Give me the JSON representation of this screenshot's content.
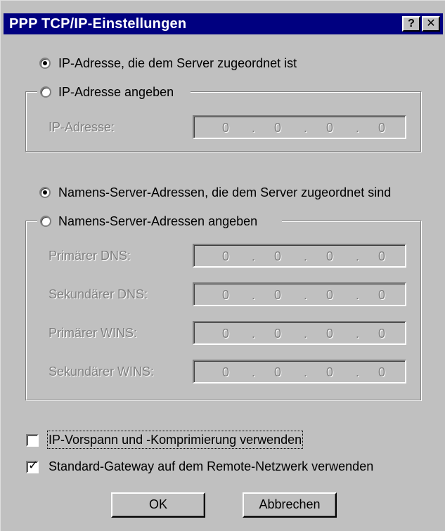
{
  "window": {
    "title": "PPP TCP/IP-Einstellungen",
    "help_glyph": "?",
    "close_glyph": "✕"
  },
  "ip": {
    "server_assigned_label": "IP-Adresse, die dem Server zugeordnet ist",
    "server_assigned_selected": true,
    "specify_label": "IP-Adresse angeben",
    "specify_selected": false,
    "field_label": "IP-Adresse:",
    "field_value": [
      "0",
      "0",
      "0",
      "0"
    ]
  },
  "dns": {
    "server_assigned_label": "Namens-Server-Adressen, die dem Server zugeordnet sind",
    "server_assigned_selected": true,
    "specify_label": "Namens-Server-Adressen angeben",
    "specify_selected": false,
    "fields": [
      {
        "label": "Primärer DNS:",
        "value": [
          "0",
          "0",
          "0",
          "0"
        ]
      },
      {
        "label": "Sekundärer DNS:",
        "value": [
          "0",
          "0",
          "0",
          "0"
        ]
      },
      {
        "label": "Primärer WINS:",
        "value": [
          "0",
          "0",
          "0",
          "0"
        ]
      },
      {
        "label": "Sekundärer WINS:",
        "value": [
          "0",
          "0",
          "0",
          "0"
        ]
      }
    ]
  },
  "options": {
    "header_compression_label": "IP-Vorspann und -Komprimierung verwenden",
    "header_compression_checked": false,
    "default_gateway_label": "Standard-Gateway auf dem Remote-Netzwerk verwenden",
    "default_gateway_checked": true
  },
  "buttons": {
    "ok": "OK",
    "cancel": "Abbrechen"
  }
}
